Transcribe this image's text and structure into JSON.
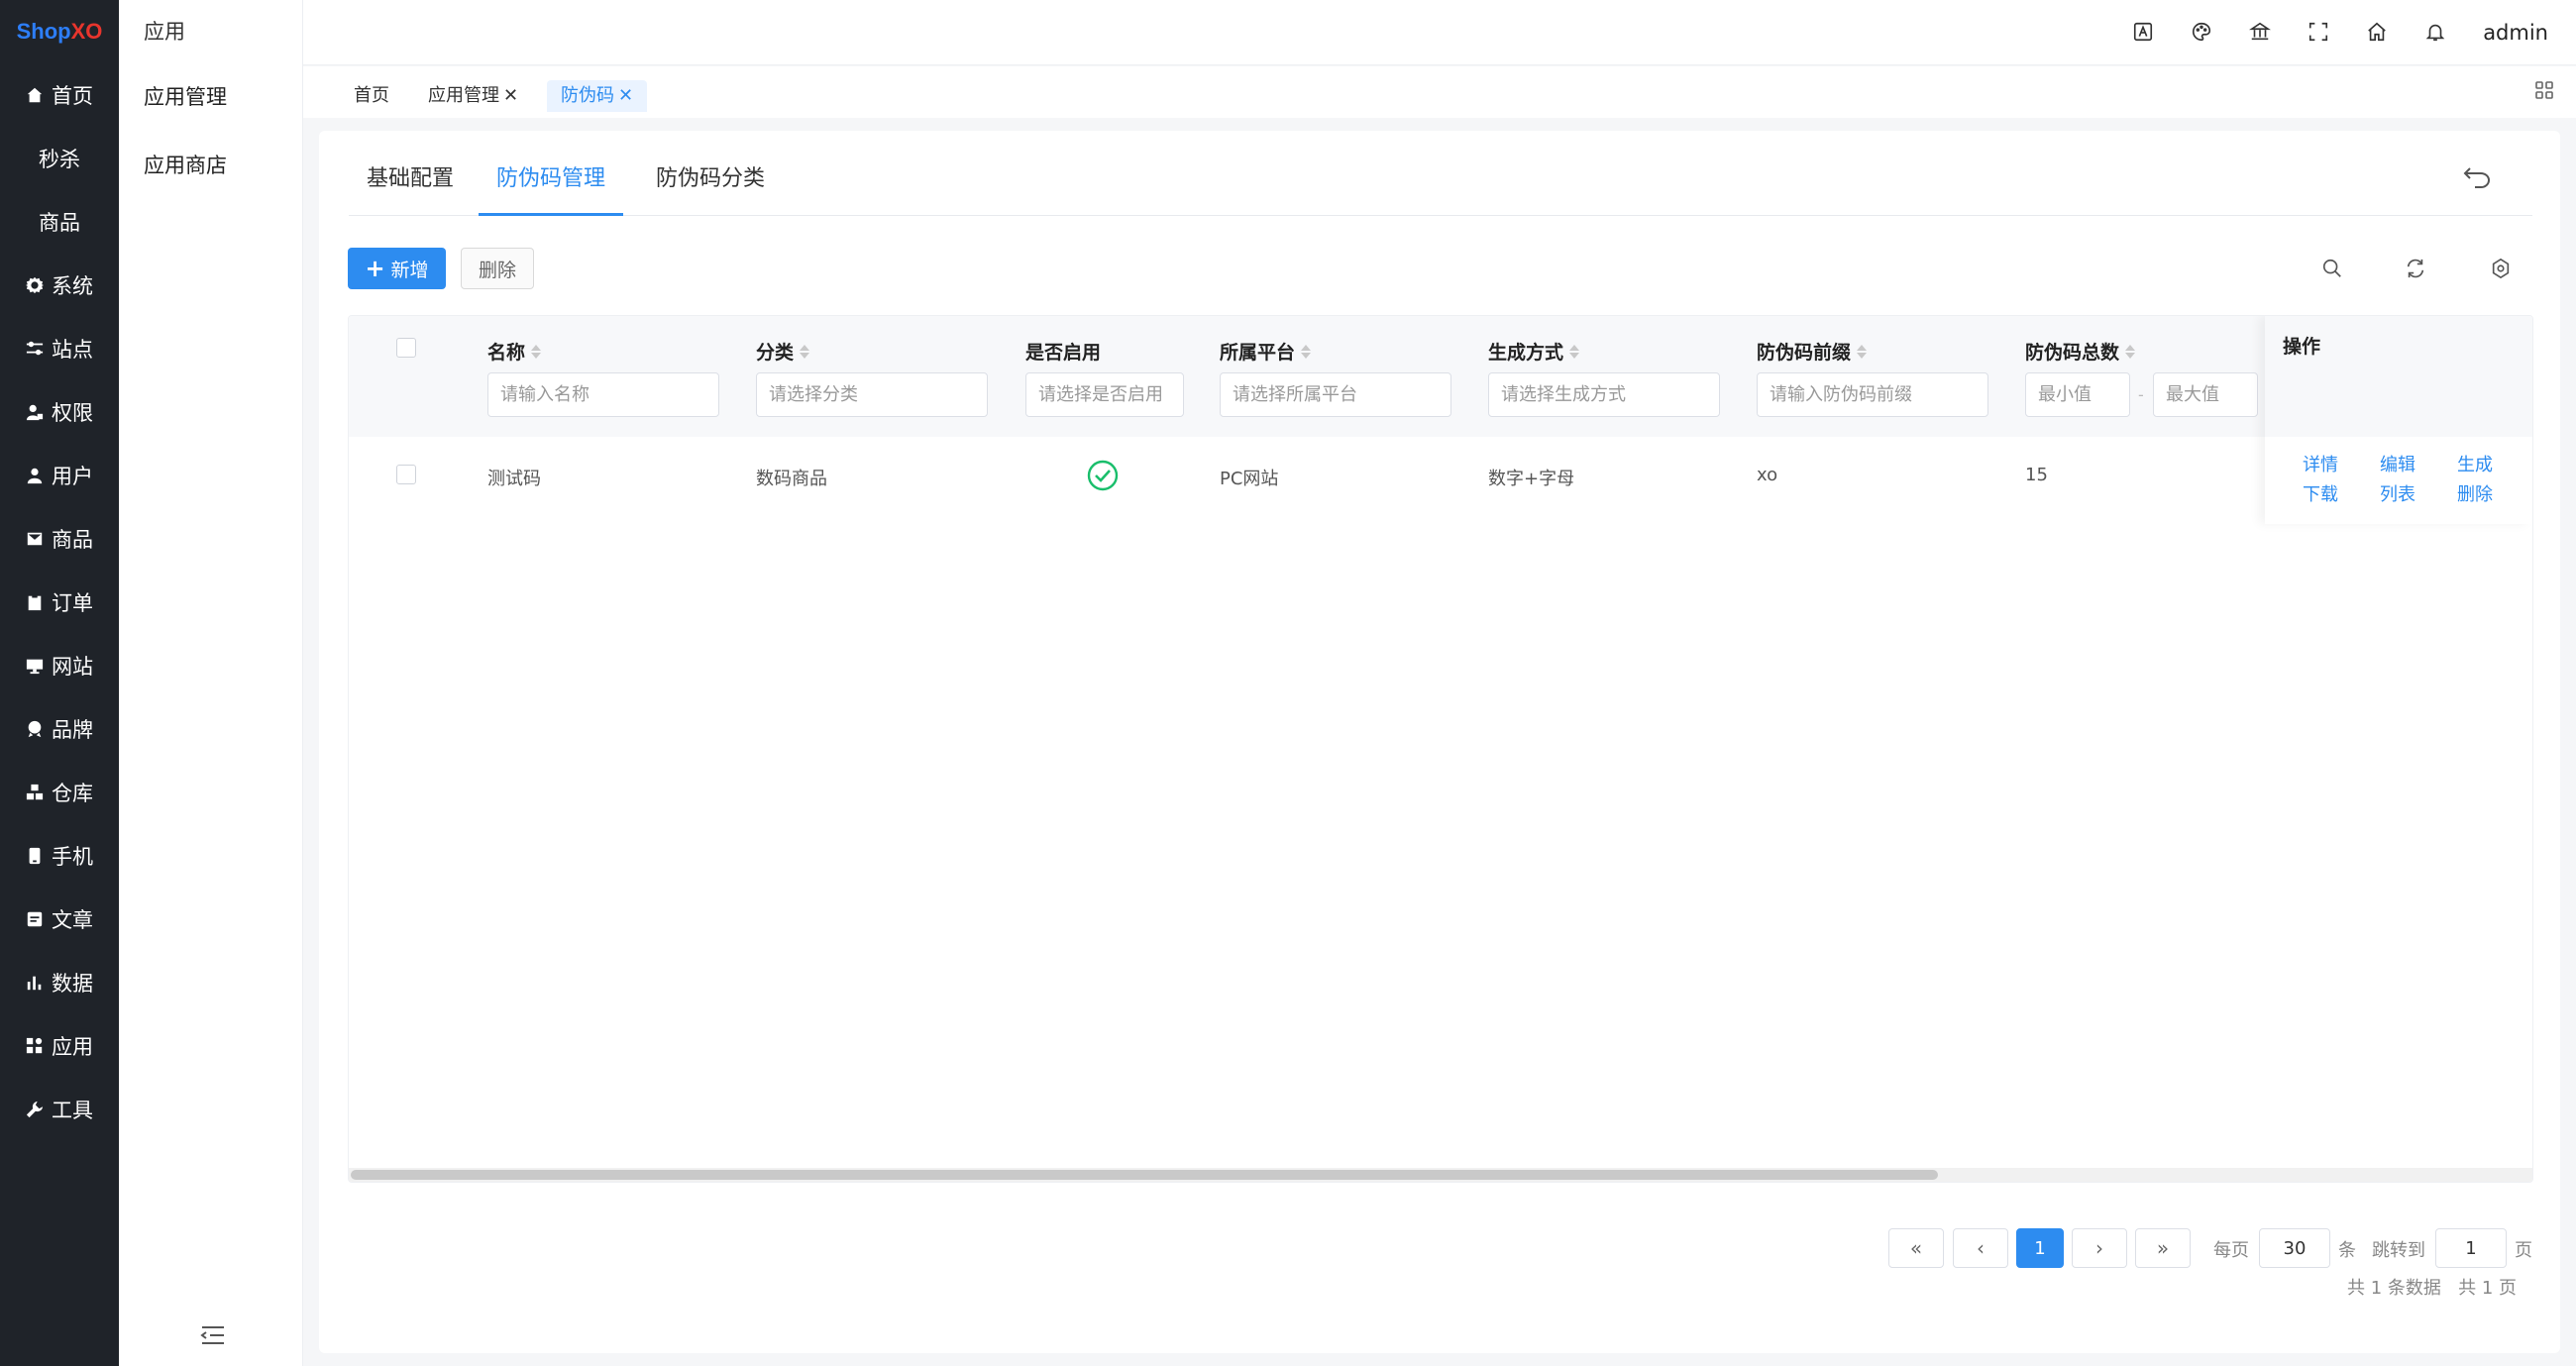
{
  "logo": {
    "part_a": "Shop",
    "part_b": "XO"
  },
  "sidebar": {
    "items": [
      {
        "label": "首页",
        "icon": "home-icon"
      },
      {
        "label": "秒杀",
        "icon": ""
      },
      {
        "label": "商品",
        "icon": ""
      },
      {
        "label": "系统",
        "icon": "gear-icon"
      },
      {
        "label": "站点",
        "icon": "sliders-icon"
      },
      {
        "label": "权限",
        "icon": "user-lock-icon"
      },
      {
        "label": "用户",
        "icon": "user-icon"
      },
      {
        "label": "商品",
        "icon": "mail-icon"
      },
      {
        "label": "订单",
        "icon": "clipboard-icon"
      },
      {
        "label": "网站",
        "icon": "monitor-icon"
      },
      {
        "label": "品牌",
        "icon": "brand-icon"
      },
      {
        "label": "仓库",
        "icon": "warehouse-icon"
      },
      {
        "label": "手机",
        "icon": "phone-icon"
      },
      {
        "label": "文章",
        "icon": "article-icon"
      },
      {
        "label": "数据",
        "icon": "bar-chart-icon"
      },
      {
        "label": "应用",
        "icon": "apps-icon"
      },
      {
        "label": "工具",
        "icon": "wrench-icon"
      }
    ]
  },
  "subbar": {
    "title": "应用",
    "items": [
      {
        "label": "应用管理"
      },
      {
        "label": "应用商店"
      }
    ]
  },
  "header": {
    "user": "admin"
  },
  "tabs": [
    {
      "label": "首页",
      "closable": false
    },
    {
      "label": "应用管理",
      "closable": true,
      "close": "✕"
    },
    {
      "label": "防伪码",
      "closable": true,
      "close": "✕"
    }
  ],
  "subtabs": [
    {
      "label": "基础配置"
    },
    {
      "label": "防伪码管理"
    },
    {
      "label": "防伪码分类"
    }
  ],
  "toolbar": {
    "add_label": "新增",
    "add_plus": "+",
    "delete_label": "删除"
  },
  "table": {
    "columns": [
      {
        "label": "名称",
        "placeholder": "请输入名称"
      },
      {
        "label": "分类",
        "placeholder": "请选择分类"
      },
      {
        "label": "是否启用",
        "placeholder": "请选择是否启用"
      },
      {
        "label": "所属平台",
        "placeholder": "请选择所属平台"
      },
      {
        "label": "生成方式",
        "placeholder": "请选择生成方式"
      },
      {
        "label": "防伪码前缀",
        "placeholder": "请输入防伪码前缀"
      },
      {
        "label": "防伪码总数",
        "placeholder_min": "最小值",
        "placeholder_max": "最大值",
        "sep": "-"
      }
    ],
    "op_header": "操作",
    "rows": [
      {
        "name": "测试码",
        "category": "数码商品",
        "enabled": true,
        "platform": "PC网站",
        "method": "数字+字母",
        "prefix": "xo",
        "total": "15",
        "actions": [
          "详情",
          "编辑",
          "生成",
          "下载",
          "列表",
          "删除"
        ]
      }
    ]
  },
  "pager": {
    "first": "«",
    "prev": "‹",
    "current": "1",
    "next": "›",
    "last": "»",
    "per_page_label": "每页",
    "per_page": "30",
    "per_unit": "条",
    "jump_label": "跳转到",
    "jump_value": "1",
    "jump_unit": "页",
    "summary": "共 1 条数据   共 1 页"
  },
  "colors": {
    "primary": "#2d8cf0",
    "sidebar_bg": "#1f2329",
    "success": "#19be6b"
  }
}
